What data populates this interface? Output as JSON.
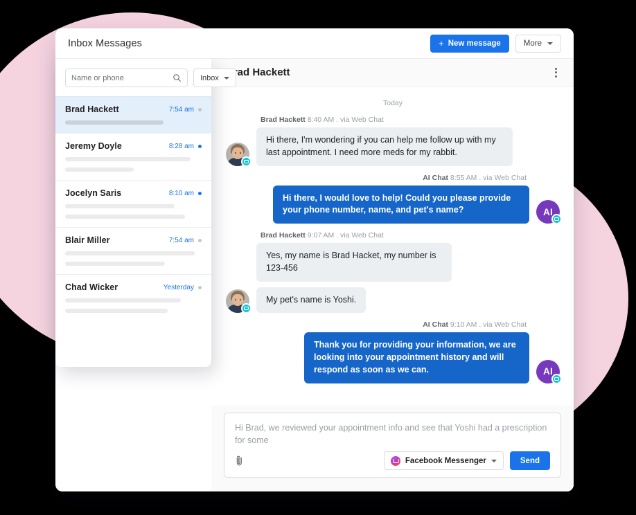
{
  "topbar": {
    "title": "Inbox Messages",
    "new_message_label": "New message",
    "new_message_icon": "plus-icon",
    "more_label": "More",
    "more_icon": "chevron-down-icon"
  },
  "sidebar": {
    "search": {
      "placeholder": "Name or phone",
      "value": "",
      "icon": "search-icon"
    },
    "folder": {
      "selected": "Inbox",
      "icon": "chevron-down-icon"
    },
    "conversations": [
      {
        "name": "Brad Hackett",
        "time": "7:54 am",
        "unread": false,
        "active": true,
        "preview_lines": [
          72
        ]
      },
      {
        "name": "Jeremy Doyle",
        "time": "8:28 am",
        "unread": true,
        "active": false,
        "preview_lines": [
          92,
          50
        ]
      },
      {
        "name": "Jocelyn Saris",
        "time": "8:10 am",
        "unread": true,
        "active": false,
        "preview_lines": [
          80,
          88
        ]
      },
      {
        "name": "Blair Miller",
        "time": "7:54 am",
        "unread": false,
        "active": false,
        "preview_lines": [
          95,
          73
        ]
      },
      {
        "name": "Chad Wicker",
        "time": "Yesterday",
        "unread": false,
        "active": false,
        "preview_lines": [
          85,
          75
        ]
      }
    ]
  },
  "chat": {
    "title": "Brad Hackett",
    "menu_icon": "kebab-menu-icon",
    "day_separator": "Today",
    "messages": [
      {
        "direction": "in",
        "sender": "Brad Hackett",
        "time": "8:40 AM",
        "channel": ". via Web Chat",
        "avatar": "photo-avatar",
        "badge_icon": "chat-bubble-badge-icon",
        "bubbles": [
          "Hi there, I'm wondering if you can help me follow up with my last appointment. I need more meds for my rabbit."
        ]
      },
      {
        "direction": "out",
        "sender": "AI Chat",
        "time": "8:55 AM",
        "channel": ". via Web Chat",
        "avatar": "ai-avatar",
        "avatar_text": "AI",
        "badge_icon": "chat-bubble-badge-icon",
        "bubbles": [
          "Hi there, I would love to help! Could you please provide your phone number, name, and pet's name?"
        ]
      },
      {
        "direction": "in",
        "sender": "Brad Hackett",
        "time": "9:07 AM",
        "channel": ". via Web Chat",
        "avatar": "photo-avatar",
        "badge_icon": "chat-bubble-badge-icon",
        "bubbles": [
          "Yes, my name is Brad Hacket, my number is 123-456",
          "My pet's name is Yoshi."
        ]
      },
      {
        "direction": "out",
        "sender": "AI Chat",
        "time": "9:10 AM",
        "channel": ". via Web Chat",
        "avatar": "ai-avatar",
        "avatar_text": "AI",
        "badge_icon": "chat-bubble-badge-icon",
        "bubbles": [
          "Thank you for providing your information, we are looking into your appointment history and will respond as soon as we can."
        ]
      }
    ]
  },
  "composer": {
    "text": "Hi Brad, we reviewed your appointment info and see that Yoshi had a prescription for some",
    "attach_icon": "paperclip-icon",
    "channel_label": "Facebook Messenger",
    "channel_icon": "facebook-messenger-icon",
    "channel_caret_icon": "chevron-down-icon",
    "send_label": "Send"
  },
  "colors": {
    "accent_blue": "#1a73e8",
    "bubble_blue": "#1566c8",
    "bubble_grey": "#eceff1",
    "active_row": "#e3effb",
    "blob_pink": "#f5d4e0",
    "ai_purple": "#7639bd",
    "badge_cyan": "#16c2d5"
  }
}
